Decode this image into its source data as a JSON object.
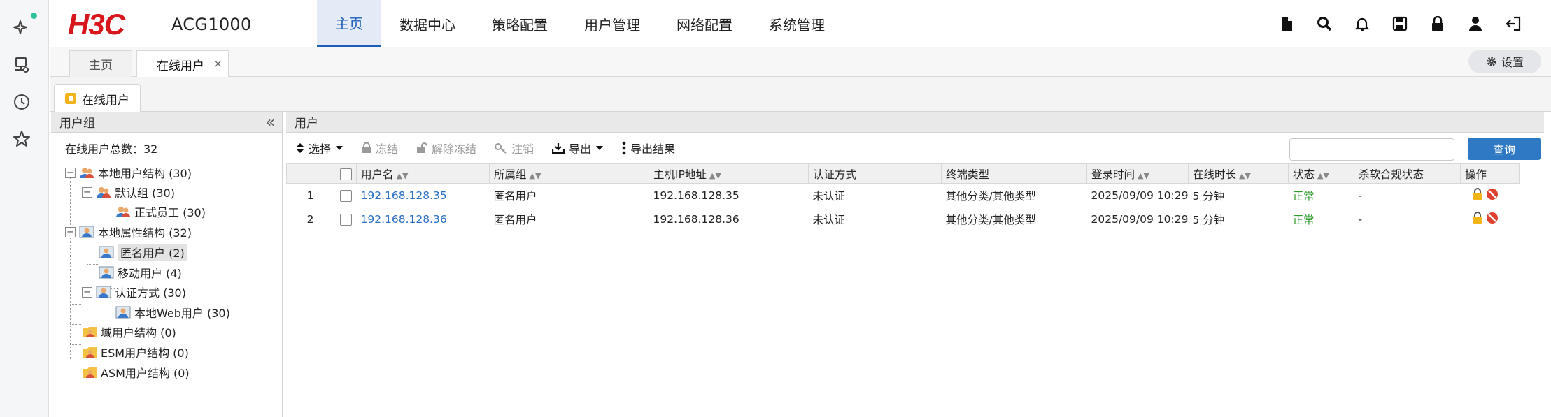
{
  "app": {
    "brand": "H3C",
    "product": "ACG1000"
  },
  "nav": {
    "items": [
      "主页",
      "数据中心",
      "策略配置",
      "用户管理",
      "网络配置",
      "系统管理"
    ],
    "active": 0
  },
  "tabs": {
    "items": [
      "主页",
      "在线用户"
    ],
    "close": "×",
    "settings": "设置"
  },
  "subtab": {
    "label": "在线用户"
  },
  "left": {
    "title": "用户组",
    "collapse": "«",
    "total": "在线用户总数：32",
    "tree": [
      {
        "label": "本地用户结构 (30)",
        "toggle": "−"
      },
      {
        "label": "默认组 (30)",
        "toggle": "−"
      },
      {
        "label": "正式员工 (30)"
      },
      {
        "label": "本地属性结构 (32)",
        "toggle": "−"
      },
      {
        "label": "匿名用户 (2)"
      },
      {
        "label": "移动用户 (4)"
      },
      {
        "label": "认证方式 (30)",
        "toggle": "−"
      },
      {
        "label": "本地Web用户 (30)"
      },
      {
        "label": "域用户结构 (0)"
      },
      {
        "label": "ESM用户结构 (0)"
      },
      {
        "label": "ASM用户结构 (0)"
      }
    ]
  },
  "right": {
    "title": "用户",
    "toolbar": {
      "select": "选择",
      "freeze": "冻结",
      "unfreeze": "解除冻结",
      "logout": "注销",
      "export": "导出",
      "export_result": "导出结果"
    },
    "search": {
      "value": "",
      "placeholder": ""
    },
    "query": "查询",
    "columns": [
      "",
      "",
      "用户名",
      "所属组",
      "主机IP地址",
      "认证方式",
      "终端类型",
      "登录时间",
      "在线时长",
      "状态",
      "杀软合规状态",
      "操作"
    ],
    "rows": [
      {
        "no": "1",
        "user": "192.168.128.35",
        "group": "匿名用户",
        "ip": "192.168.128.35",
        "auth": "未认证",
        "terminal": "其他分类/其他类型",
        "login": "2025/09/09 10:29",
        "duration": "5 分钟",
        "status": "正常",
        "av": "-"
      },
      {
        "no": "2",
        "user": "192.168.128.36",
        "group": "匿名用户",
        "ip": "192.168.128.36",
        "auth": "未认证",
        "terminal": "其他分类/其他类型",
        "login": "2025/09/09 10:29",
        "duration": "5 分钟",
        "status": "正常",
        "av": "-"
      }
    ]
  },
  "colors": {
    "accent": "#1d5fb8",
    "brand_red": "#d8171c",
    "ok": "#2a9a2a",
    "link": "#2a6fc4"
  }
}
